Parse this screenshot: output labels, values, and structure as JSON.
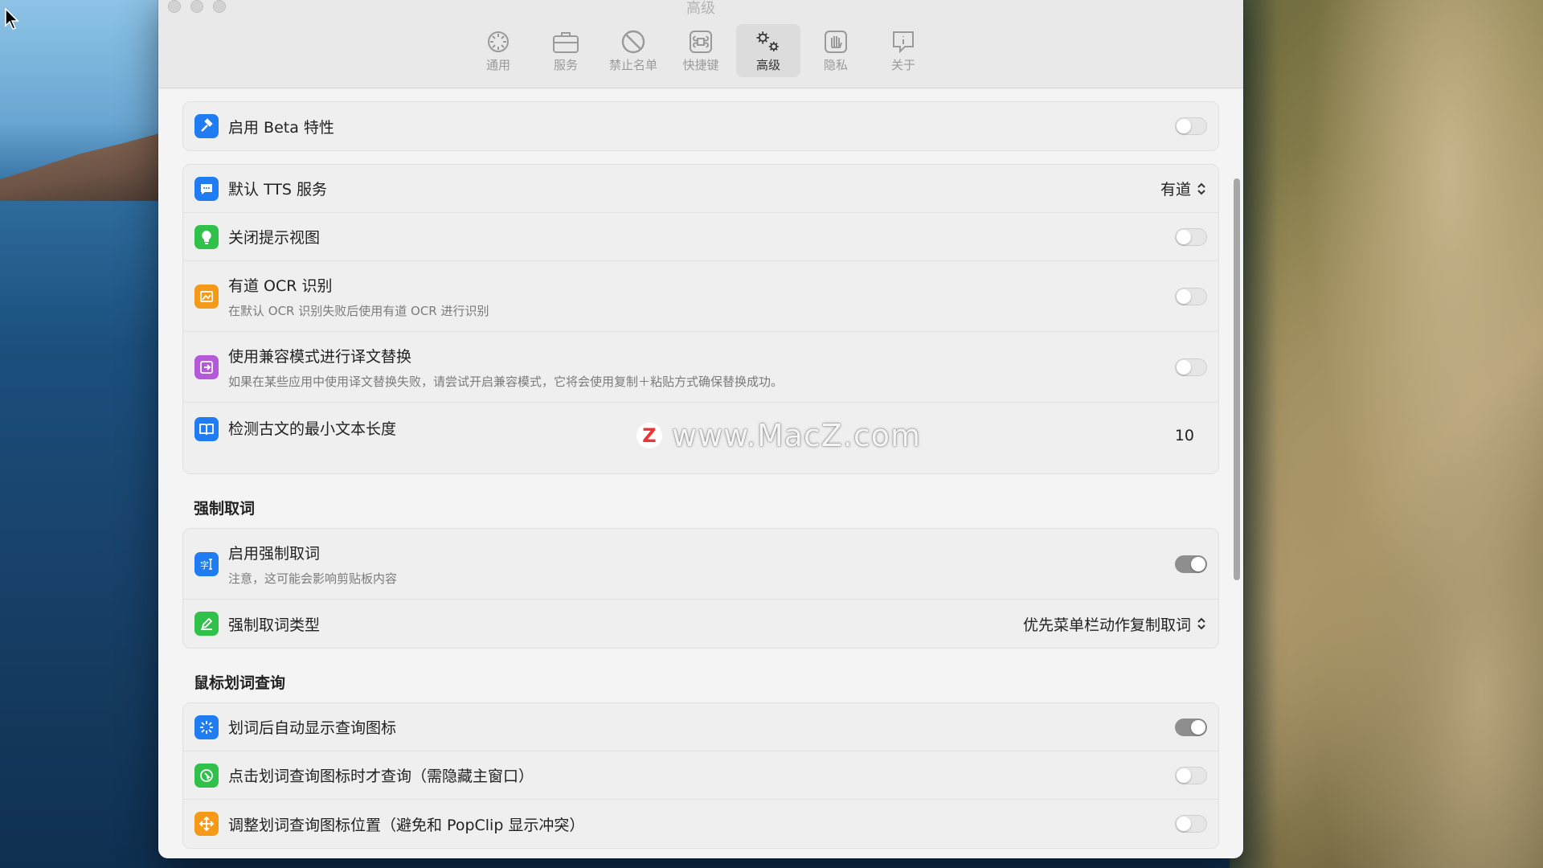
{
  "window": {
    "title": "高级"
  },
  "toolbar": [
    {
      "label": "通用",
      "icon": "gear-outline-icon",
      "active": false
    },
    {
      "label": "服务",
      "icon": "briefcase-icon",
      "active": false
    },
    {
      "label": "禁止名单",
      "icon": "prohibited-icon",
      "active": false
    },
    {
      "label": "快捷键",
      "icon": "command-key-icon",
      "active": false
    },
    {
      "label": "高级",
      "icon": "gears-icon",
      "active": true
    },
    {
      "label": "隐私",
      "icon": "hand-icon",
      "active": false
    },
    {
      "label": "关于",
      "icon": "info-icon",
      "active": false
    }
  ],
  "beta": {
    "label": "启用 Beta 特性",
    "enabled": false
  },
  "general": {
    "tts": {
      "label": "默认 TTS 服务",
      "value": "有道"
    },
    "hint": {
      "label": "关闭提示视图",
      "enabled": false
    },
    "ocr": {
      "label": "有道 OCR 识别",
      "desc": "在默认 OCR 识别失败后使用有道 OCR 进行识别",
      "enabled": false
    },
    "compat": {
      "label": "使用兼容模式进行译文替换",
      "desc": "如果在某些应用中使用译文替换失败，请尝试开启兼容模式，它将会使用复制＋粘贴方式确保替换成功。",
      "enabled": false
    },
    "minlen": {
      "label": "检测古文的最小文本长度",
      "value": "10"
    }
  },
  "force_section": {
    "title": "强制取词",
    "enable": {
      "label": "启用强制取词",
      "desc": "注意，这可能会影响剪贴板内容",
      "enabled": true
    },
    "type": {
      "label": "强制取词类型",
      "value": "优先菜单栏动作复制取词"
    }
  },
  "mouse_section": {
    "title": "鼠标划词查询",
    "auto_icon": {
      "label": "划词后自动显示查询图标",
      "enabled": true
    },
    "click_query": {
      "label": "点击划词查询图标时才查询（需隐藏主窗口）",
      "enabled": false
    },
    "adjust_pos": {
      "label": "调整划词查询图标位置（避免和 PopClip 显示冲突）",
      "enabled": false
    }
  },
  "watermark": {
    "text": "www.MacZ.com",
    "logo": "Z"
  },
  "colors": {
    "blue": "#1f7cf2",
    "green": "#30c14b",
    "orange": "#f59a18",
    "purple": "#b45ad8"
  }
}
